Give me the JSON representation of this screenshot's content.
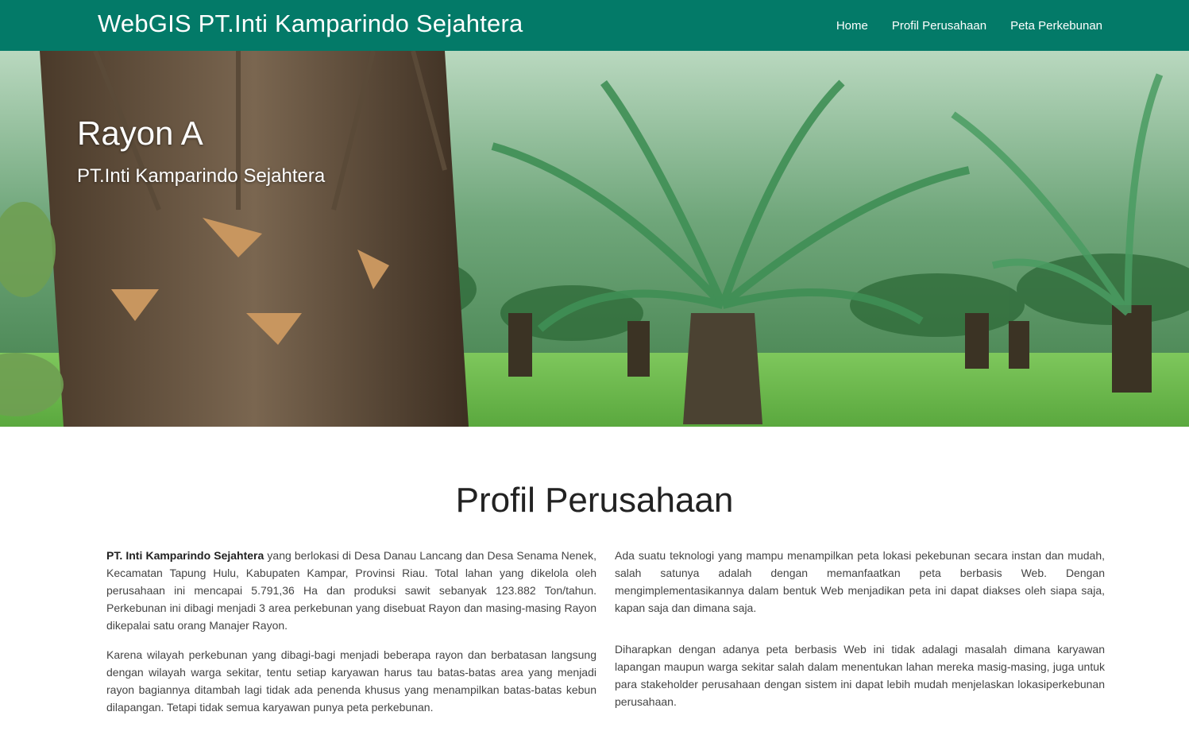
{
  "navbar": {
    "brand": "WebGIS PT.Inti Kamparindo Sejahtera",
    "links": [
      "Home",
      "Profil Perusahaan",
      "Peta Perkebunan"
    ],
    "background": "#037a68"
  },
  "hero": {
    "title": "Rayon A",
    "subtitle": "PT.Inti Kamparindo Sejahtera"
  },
  "profile": {
    "title": "Profil Perusahaan",
    "left_p1_strong": "PT. Inti Kamparindo Sejahtera",
    "left_p1_rest": " yang berlokasi di Desa Danau Lancang dan Desa Senama Nenek, Kecamatan Tapung Hulu, Kabupaten Kampar, Provinsi Riau. Total lahan yang dikelola oleh perusahaan ini mencapai 5.791,36 Ha dan produksi sawit sebanyak 123.882 Ton/tahun. Perkebunan ini dibagi menjadi 3 area perkebunan yang disebuat Rayon dan masing-masing Rayon dikepalai satu orang Manajer Rayon.",
    "left_p2": "Karena wilayah perkebunan yang dibagi-bagi menjadi beberapa rayon dan berbatasan langsung dengan wilayah warga sekitar, tentu setiap karyawan harus tau batas-batas area yang menjadi rayon bagiannya ditambah lagi tidak ada penenda khusus yang menampilkan batas-batas kebun dilapangan. Tetapi tidak semua karyawan punya peta perkebunan.",
    "right_p1": "Ada suatu teknologi yang mampu menampilkan peta lokasi pekebunan secara instan dan mudah, salah satunya adalah dengan memanfaatkan peta berbasis Web. Dengan mengimplementasikannya dalam bentuk Web menjadikan peta ini dapat diakses oleh siapa saja, kapan saja dan dimana saja.",
    "right_p2": "Diharapkan dengan adanya peta berbasis Web ini tidak adalagi masalah dimana karyawan lapangan maupun warga sekitar salah dalam menentukan lahan mereka masig-masing, juga untuk para stakeholder perusahaan dengan sistem ini dapat lebih mudah menjelaskan lokasiperkebunan perusahaan."
  }
}
